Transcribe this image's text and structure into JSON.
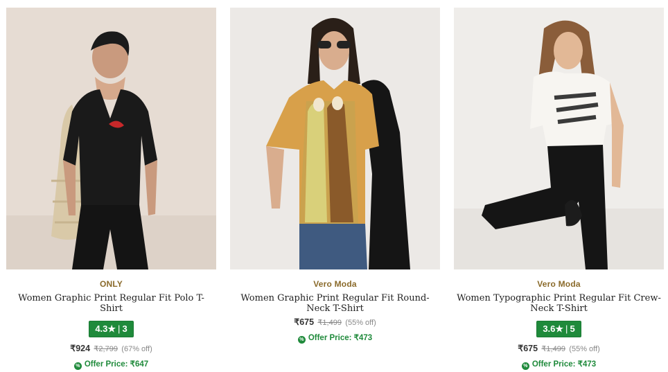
{
  "products": [
    {
      "brand": "ONLY",
      "title": "Women Graphic Print Regular Fit Polo T-Shirt",
      "rating": "4.3★",
      "rating_sep": "|",
      "rating_count": "3",
      "price": "₹924",
      "mrp": "₹2,799",
      "discount": "(67% off)",
      "offer_label": "Offer Price: ₹647",
      "offer_icon": "%"
    },
    {
      "brand": "Vero Moda",
      "title": "Women Graphic Print Regular Fit Round-Neck T-Shirt",
      "price": "₹675",
      "mrp": "₹1,499",
      "discount": "(55% off)",
      "offer_label": "Offer Price: ₹473",
      "offer_icon": "%"
    },
    {
      "brand": "Vero Moda",
      "title": "Women Typographic Print Regular Fit Crew-Neck T-Shirt",
      "rating": "3.6★",
      "rating_sep": "|",
      "rating_count": "5",
      "price": "₹675",
      "mrp": "₹1,499",
      "discount": "(55% off)",
      "offer_label": "Offer Price: ₹473",
      "offer_icon": "%"
    }
  ],
  "colors": {
    "brand_text": "#8a6a2a",
    "rating_bg": "#1f8a3b",
    "offer_green": "#1f8a3b"
  }
}
